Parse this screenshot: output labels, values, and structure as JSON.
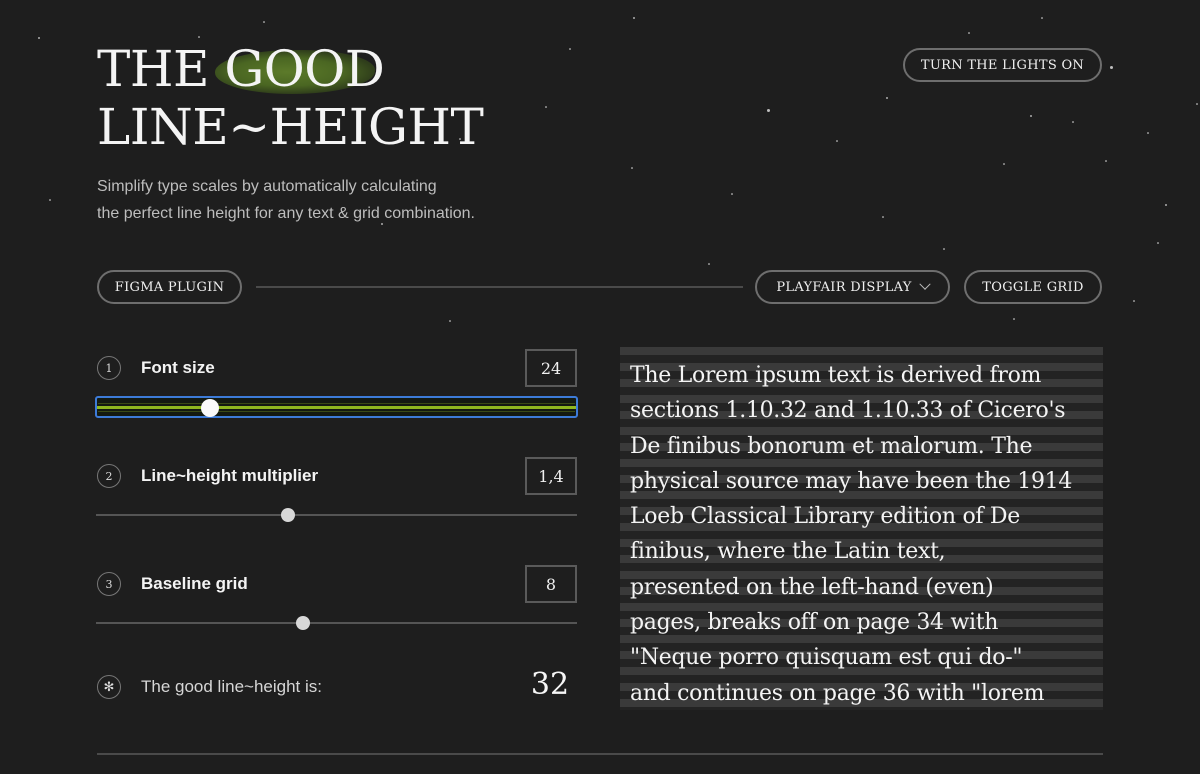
{
  "header": {
    "title_line1": "THE GOOD",
    "title_line2": "LINE~HEIGHT",
    "subtitle_line1": "Simplify type scales by automatically calculating",
    "subtitle_line2": "the perfect line height for any text & grid combination.",
    "lights_button": "TURN THE LIGHTS ON"
  },
  "toolbar": {
    "figma_button": "FIGMA PLUGIN",
    "font_select": "PLAYFAIR DISPLAY",
    "grid_button": "TOGGLE GRID"
  },
  "controls": [
    {
      "number": "1",
      "label": "Font size",
      "value": "24",
      "slider_fraction": 0.235
    },
    {
      "number": "2",
      "label": "Line~height multiplier",
      "value": "1,4",
      "slider_fraction": 0.4
    },
    {
      "number": "3",
      "label": "Baseline grid",
      "value": "8",
      "slider_fraction": 0.43
    }
  ],
  "result": {
    "icon": "✻",
    "label": "The good line~height is:",
    "value": "32"
  },
  "preview": {
    "lines": [
      "The Lorem ipsum text is derived from",
      "sections 1.10.32 and 1.10.33 of Cicero's",
      "De finibus bonorum et malorum. The",
      "physical source may have been the 1914",
      "Loeb Classical Library edition of De",
      "finibus, where the Latin text,",
      "presented on the left-hand (even)",
      "pages, breaks off on page 34 with",
      "\"Neque porro quisquam est qui do-\"",
      "and continues on page 36 with \"lorem"
    ]
  },
  "colors": {
    "background": "#1e1e1e",
    "accent_green": "#8fb81f",
    "focus_blue": "#3d7bd8",
    "title_blob": "#4a6622"
  }
}
